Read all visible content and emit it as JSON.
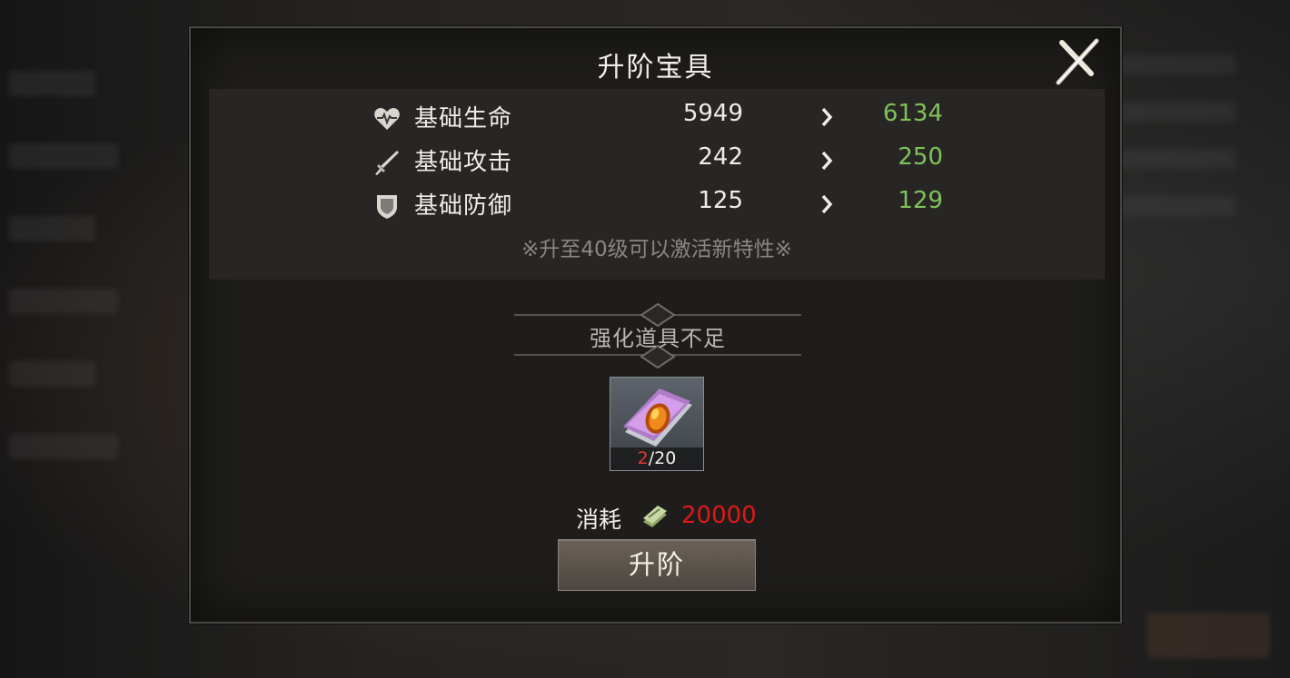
{
  "dialog": {
    "title": "升阶宝具",
    "close_icon": "close-x-icon"
  },
  "stats": [
    {
      "icon": "heart-icon",
      "label": "基础生命",
      "current": "5949",
      "next": "6134"
    },
    {
      "icon": "sword-icon",
      "label": "基础攻击",
      "current": "242",
      "next": "250"
    },
    {
      "icon": "shield-icon",
      "label": "基础防御",
      "current": "125",
      "next": "129"
    }
  ],
  "stat_note": "※升至40级可以激活新特性※",
  "material": {
    "status": "强化道具不足",
    "item_icon": "purple-gem-book-icon",
    "have": "2",
    "need": "/20"
  },
  "cost": {
    "label": "消耗",
    "icon": "cash-icon",
    "value": "20000"
  },
  "upgrade_button": "升阶",
  "colors": {
    "stat_next": "#7ec25a",
    "insufficient_count": "#e23b2e",
    "cost_value": "#e01818"
  }
}
